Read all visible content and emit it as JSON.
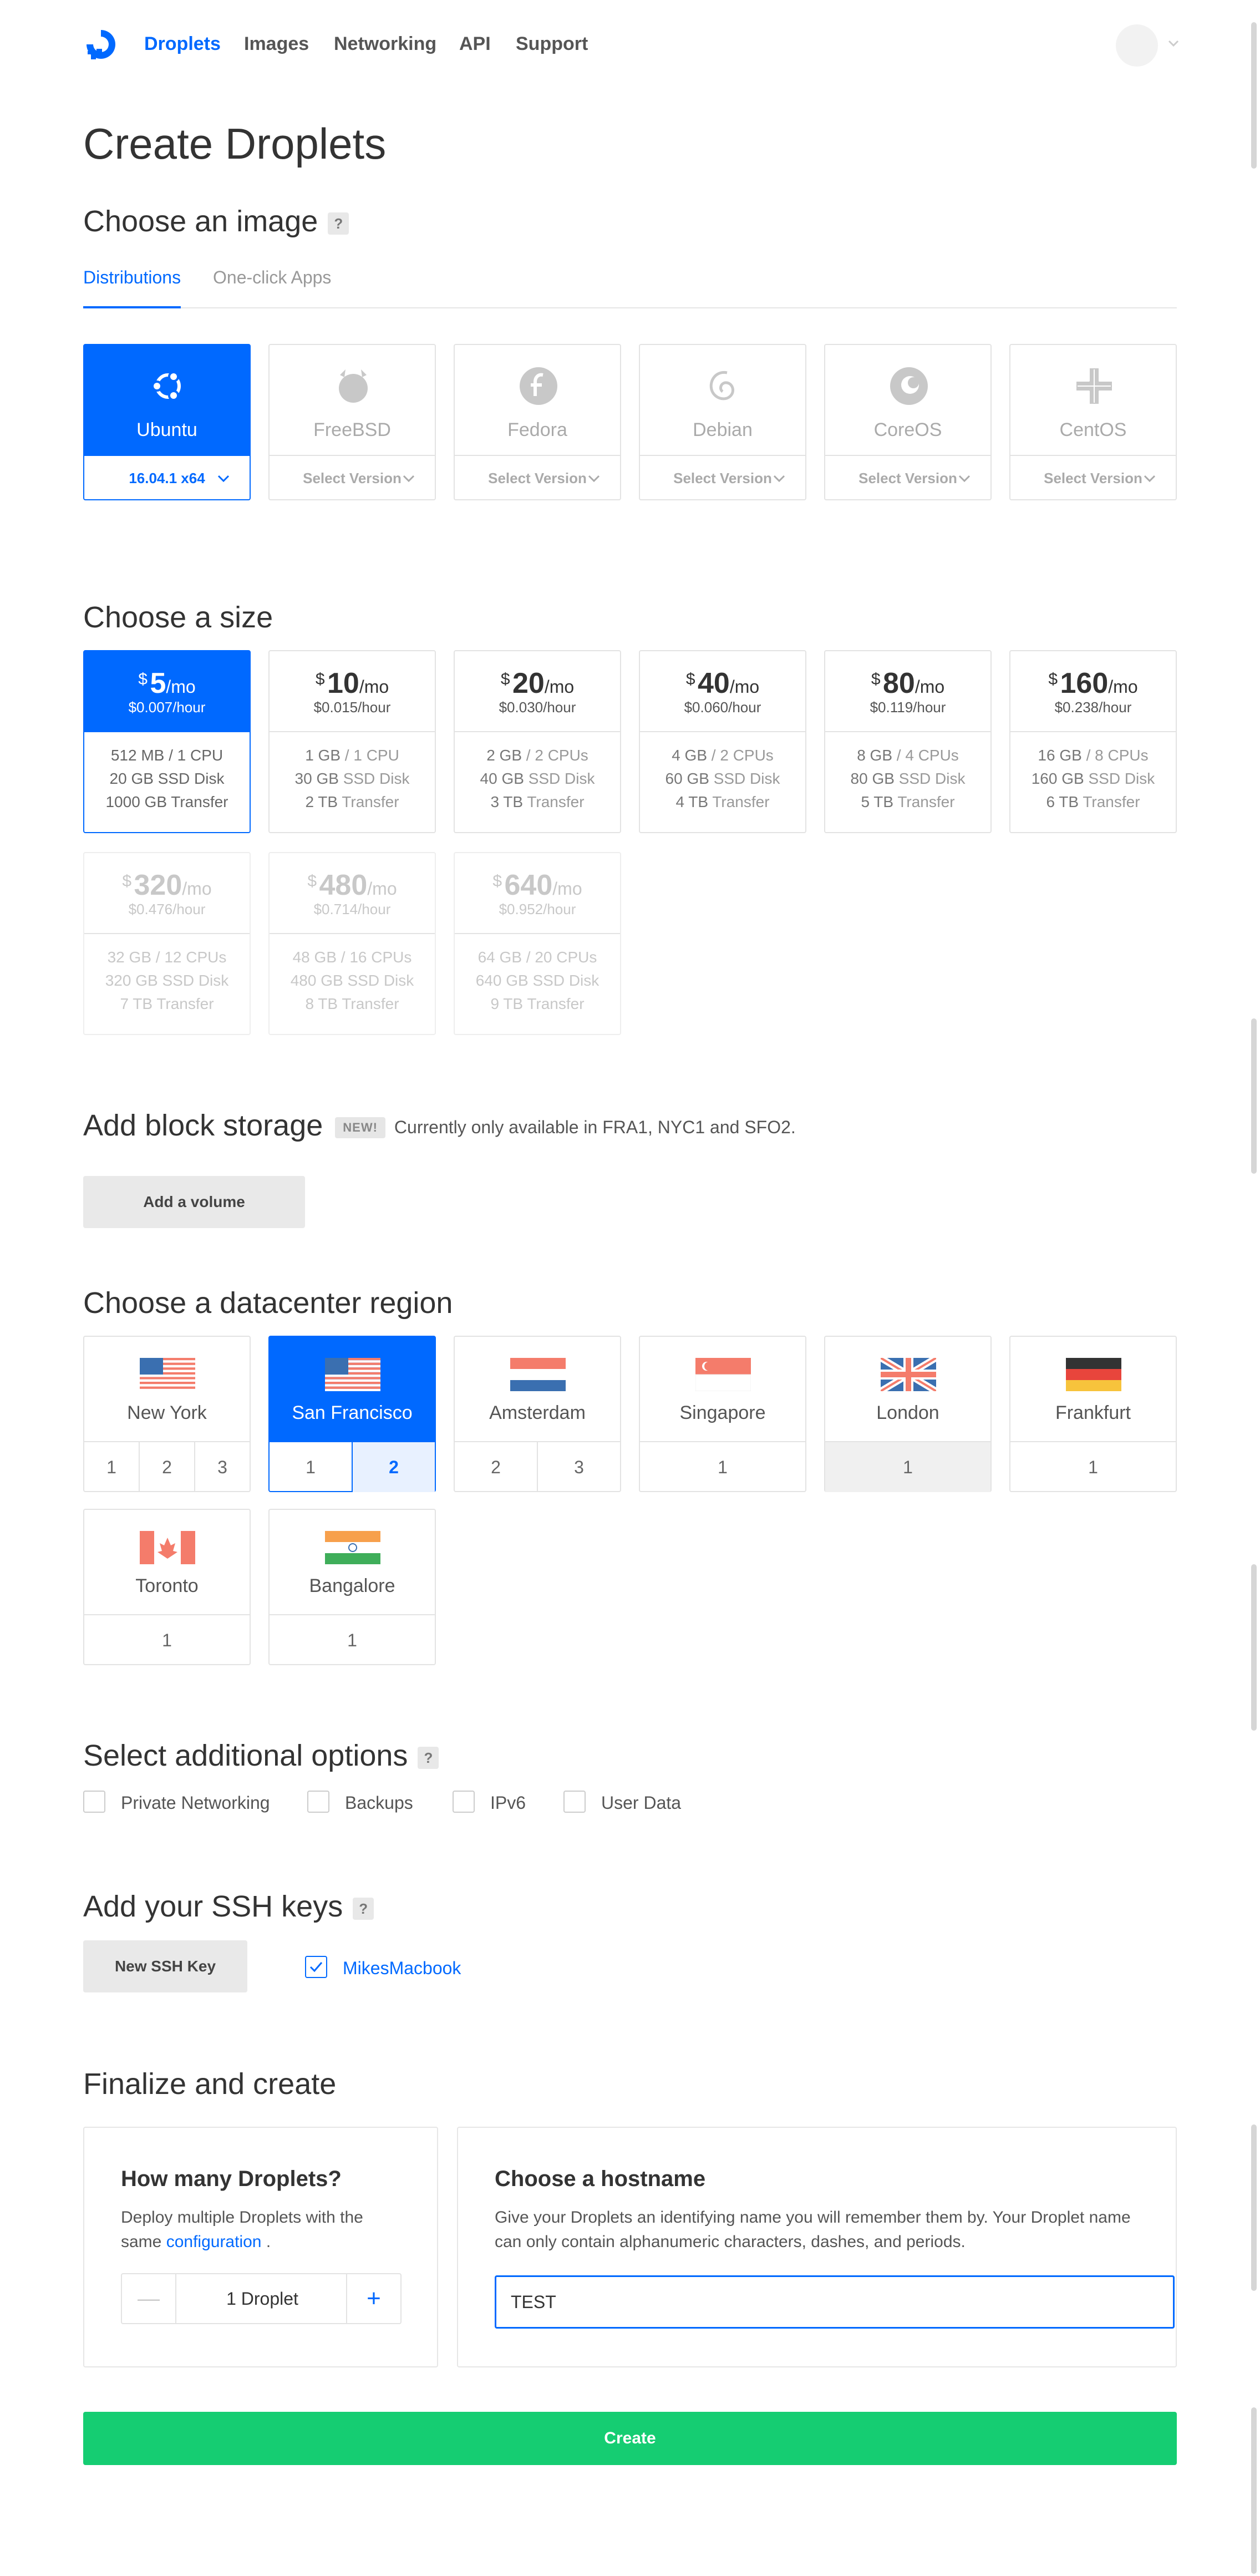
{
  "nav": {
    "items": [
      "Droplets",
      "Images",
      "Networking",
      "API",
      "Support"
    ],
    "active": "Droplets"
  },
  "page": {
    "title": "Create Droplets"
  },
  "image_section": {
    "title": "Choose an image",
    "help": "?",
    "tabs": [
      "Distributions",
      "One-click Apps"
    ],
    "distros": [
      {
        "name": "Ubuntu",
        "version": "16.04.1 x64",
        "selected": true,
        "icon": "ubuntu-icon"
      },
      {
        "name": "FreeBSD",
        "version": "Select Version",
        "icon": "freebsd-icon"
      },
      {
        "name": "Fedora",
        "version": "Select Version",
        "icon": "fedora-icon"
      },
      {
        "name": "Debian",
        "version": "Select Version",
        "icon": "debian-icon"
      },
      {
        "name": "CoreOS",
        "version": "Select Version",
        "icon": "coreos-icon"
      },
      {
        "name": "CentOS",
        "version": "Select Version",
        "icon": "centos-icon"
      }
    ]
  },
  "size_section": {
    "title": "Choose a size",
    "currency": "$",
    "per_month": "/mo",
    "plans": [
      {
        "price": "5",
        "hourly": "$0.007/hour",
        "mem": "512 MB",
        "cpu": "/ 1 CPU",
        "disk": "20 GB",
        "disk_label": "SSD Disk",
        "transfer": "1000 GB",
        "transfer_label": "Transfer",
        "selected": true
      },
      {
        "price": "10",
        "hourly": "$0.015/hour",
        "mem": "1 GB",
        "cpu": "/ 1 CPU",
        "disk": "30 GB",
        "disk_label": "SSD Disk",
        "transfer": "2 TB",
        "transfer_label": "Transfer"
      },
      {
        "price": "20",
        "hourly": "$0.030/hour",
        "mem": "2 GB",
        "cpu": "/ 2 CPUs",
        "disk": "40 GB",
        "disk_label": "SSD Disk",
        "transfer": "3 TB",
        "transfer_label": "Transfer"
      },
      {
        "price": "40",
        "hourly": "$0.060/hour",
        "mem": "4 GB",
        "cpu": "/ 2 CPUs",
        "disk": "60 GB",
        "disk_label": "SSD Disk",
        "transfer": "4 TB",
        "transfer_label": "Transfer"
      },
      {
        "price": "80",
        "hourly": "$0.119/hour",
        "mem": "8 GB",
        "cpu": "/ 4 CPUs",
        "disk": "80 GB",
        "disk_label": "SSD Disk",
        "transfer": "5 TB",
        "transfer_label": "Transfer"
      },
      {
        "price": "160",
        "hourly": "$0.238/hour",
        "mem": "16 GB",
        "cpu": "/ 8 CPUs",
        "disk": "160 GB",
        "disk_label": "SSD Disk",
        "transfer": "6 TB",
        "transfer_label": "Transfer"
      },
      {
        "price": "320",
        "hourly": "$0.476/hour",
        "mem": "32 GB",
        "cpu": "/ 12 CPUs",
        "disk": "320 GB",
        "disk_label": "SSD Disk",
        "transfer": "7 TB",
        "transfer_label": "Transfer",
        "disabled": true
      },
      {
        "price": "480",
        "hourly": "$0.714/hour",
        "mem": "48 GB",
        "cpu": "/ 16 CPUs",
        "disk": "480 GB",
        "disk_label": "SSD Disk",
        "transfer": "8 TB",
        "transfer_label": "Transfer",
        "disabled": true
      },
      {
        "price": "640",
        "hourly": "$0.952/hour",
        "mem": "64 GB",
        "cpu": "/ 20 CPUs",
        "disk": "640 GB",
        "disk_label": "SSD Disk",
        "transfer": "9 TB",
        "transfer_label": "Transfer",
        "disabled": true
      }
    ]
  },
  "storage_section": {
    "title": "Add block storage",
    "badge": "NEW!",
    "note": "Currently only available in FRA1, NYC1 and SFO2.",
    "button": "Add a volume"
  },
  "region_section": {
    "title": "Choose a datacenter region",
    "regions": [
      {
        "name": "New York",
        "numbers": [
          "1",
          "2",
          "3"
        ],
        "flag": "us-flag"
      },
      {
        "name": "San Francisco",
        "numbers": [
          "1",
          "2"
        ],
        "selected": true,
        "selected_number": "2",
        "flag": "us-flag"
      },
      {
        "name": "Amsterdam",
        "numbers": [
          "2",
          "3"
        ],
        "flag": "nl-flag"
      },
      {
        "name": "Singapore",
        "numbers": [
          "1"
        ],
        "flag": "sg-flag"
      },
      {
        "name": "London",
        "numbers": [
          "1"
        ],
        "flag": "uk-flag",
        "hover": true
      },
      {
        "name": "Frankfurt",
        "numbers": [
          "1"
        ],
        "flag": "de-flag"
      },
      {
        "name": "Toronto",
        "numbers": [
          "1"
        ],
        "flag": "ca-flag"
      },
      {
        "name": "Bangalore",
        "numbers": [
          "1"
        ],
        "flag": "in-flag"
      }
    ]
  },
  "options_section": {
    "title": "Select additional options",
    "help": "?",
    "options": [
      "Private Networking",
      "Backups",
      "IPv6",
      "User Data"
    ]
  },
  "ssh_section": {
    "title": "Add your SSH keys",
    "help": "?",
    "button": "New SSH Key",
    "key": "MikesMacbook"
  },
  "finalize_section": {
    "title": "Finalize and create",
    "count_title": "How many Droplets?",
    "count_desc_1": "Deploy multiple Droplets with the",
    "count_desc_2": "same",
    "count_link": "configuration",
    "count_desc_3": ".",
    "count_value": "1  Droplet",
    "minus": "—",
    "plus": "+",
    "hostname_title": "Choose a hostname",
    "hostname_desc": "Give your Droplets an identifying name you will remember them by. Your Droplet name can only contain alphanumeric characters, dashes, and periods.",
    "hostname_value": "TEST",
    "create_button": "Create"
  },
  "colors": {
    "accent": "#0069ff",
    "create": "#15cd72"
  }
}
